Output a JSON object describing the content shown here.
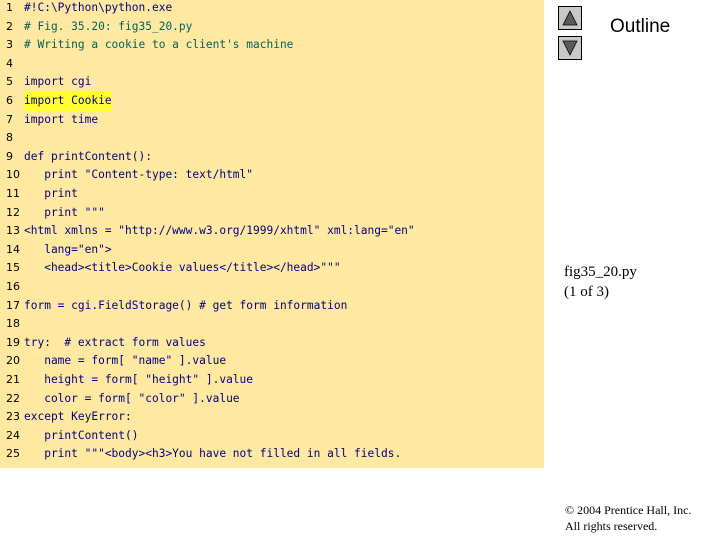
{
  "outline_label": "Outline",
  "nav": {
    "up_icon": "triangle-up-icon",
    "down_icon": "triangle-down-icon"
  },
  "figure": {
    "name": "fig35_20.py",
    "page": "(1 of 3)"
  },
  "footer": {
    "line1": "© 2004 Prentice Hall, Inc.",
    "line2": "All rights reserved."
  },
  "colors": {
    "code_bg": "#ffe9a0",
    "highlight": "#ffff33",
    "code_text": "#000080"
  },
  "code": {
    "lines": [
      {
        "n": "1",
        "t": "#!C:\\Python\\python.exe"
      },
      {
        "n": "2",
        "t": "# Fig. 35.20: fig35_20.py"
      },
      {
        "n": "3",
        "t": "# Writing a cookie to a client's machine"
      },
      {
        "n": "4",
        "t": ""
      },
      {
        "n": "5",
        "t": "import cgi"
      },
      {
        "n": "6",
        "t": "import Cookie"
      },
      {
        "n": "7",
        "t": "import time"
      },
      {
        "n": "8",
        "t": ""
      },
      {
        "n": "9",
        "t": "def printContent():"
      },
      {
        "n": "10",
        "t": "   print \"Content-type: text/html\""
      },
      {
        "n": "11",
        "t": "   print"
      },
      {
        "n": "12",
        "t": "   print \"\"\""
      },
      {
        "n": "13",
        "t": "<html xmlns = \"http://www.w3.org/1999/xhtml\" xml:lang=\"en\""
      },
      {
        "n": "14",
        "t": "   lang=\"en\">"
      },
      {
        "n": "15",
        "t": "   <head><title>Cookie values</title></head>\"\"\""
      },
      {
        "n": "16",
        "t": ""
      },
      {
        "n": "17",
        "t": "form = cgi.FieldStorage() # get form information"
      },
      {
        "n": "18",
        "t": ""
      },
      {
        "n": "19",
        "t": "try:  # extract form values"
      },
      {
        "n": "20",
        "t": "   name = form[ \"name\" ].value"
      },
      {
        "n": "21",
        "t": "   height = form[ \"height\" ].value"
      },
      {
        "n": "22",
        "t": "   color = form[ \"color\" ].value"
      },
      {
        "n": "23",
        "t": "except KeyError:"
      },
      {
        "n": "24",
        "t": "   printContent()"
      },
      {
        "n": "25",
        "t": "   print \"\"\"<body><h3>You have not filled in all fields."
      }
    ]
  }
}
